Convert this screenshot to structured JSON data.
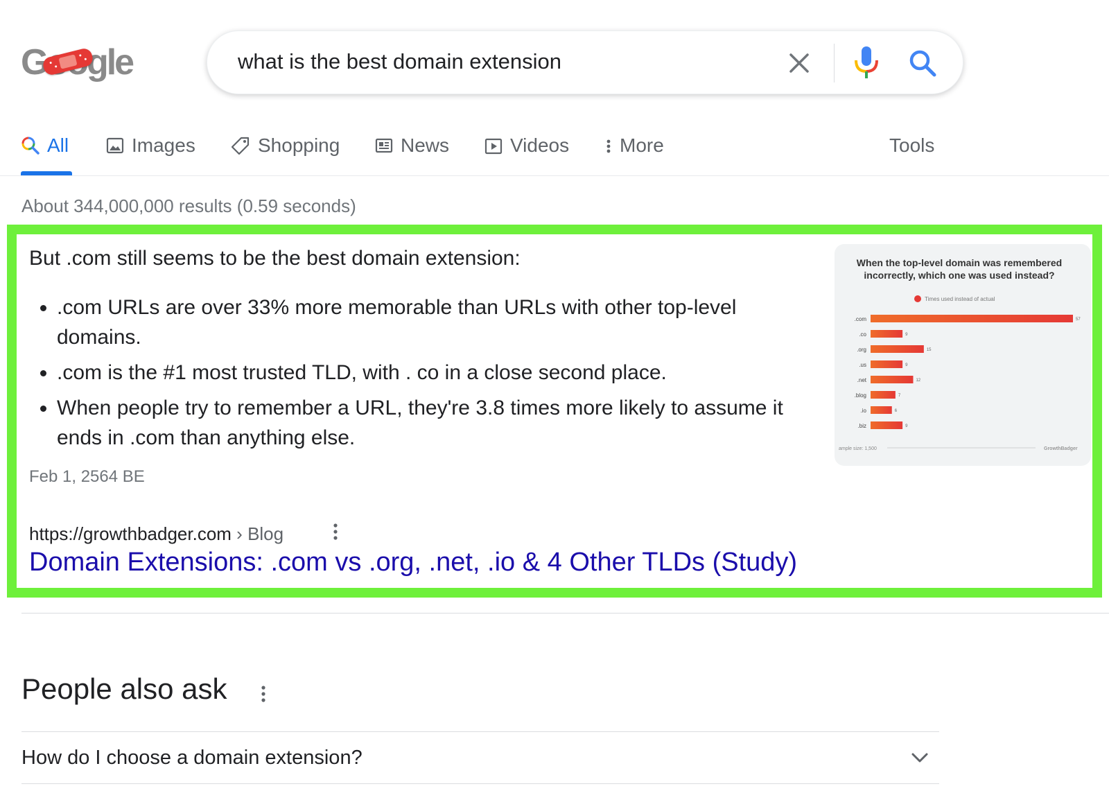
{
  "logo": {
    "text": "Google"
  },
  "search": {
    "query": "what is the best domain extension"
  },
  "tabs": [
    {
      "label": "All",
      "icon": "search-icon"
    },
    {
      "label": "Images",
      "icon": "image-icon"
    },
    {
      "label": "Shopping",
      "icon": "tag-icon"
    },
    {
      "label": "News",
      "icon": "newspaper-icon"
    },
    {
      "label": "Videos",
      "icon": "play-icon"
    },
    {
      "label": "More",
      "icon": "more-vert-icon"
    }
  ],
  "tools_label": "Tools",
  "stats": "About 344,000,000 results (0.59 seconds)",
  "snippet": {
    "heading": "But .com still seems to be the best domain extension:",
    "bullets": [
      ".com URLs are over 33% more memorable than URLs with other top-level domains.",
      ".com is the #1 most trusted TLD, with . co in a close second place.",
      "When people try to remember a URL, they're 3.8 times more likely to assume it ends in .com than anything else."
    ],
    "date": "Feb 1, 2564 BE",
    "cite_url": "https://growthbadger.com",
    "cite_sep": " › ",
    "cite_path": "Blog",
    "title": "Domain Extensions: .com vs .org, .net, .io & 4 Other TLDs (Study)"
  },
  "chart_data": {
    "type": "bar",
    "orientation": "horizontal",
    "title": "When the top-level domain was remembered incorrectly, which one was used instead?",
    "legend": [
      "Times used instead of actual"
    ],
    "categories": [
      ".com",
      ".co",
      ".org",
      ".us",
      ".net",
      ".blog",
      ".io",
      ".biz"
    ],
    "values": [
      57,
      9,
      15,
      9,
      12,
      7,
      6,
      9
    ],
    "footer_left": "ample size: 1,500",
    "footer_right": "GrowthBadger",
    "colors": {
      "bar_start": "#ef6c2a",
      "bar_end": "#e53935"
    }
  },
  "people_also_ask": {
    "title": "People also ask",
    "questions": [
      "How do I choose a domain extension?"
    ]
  }
}
